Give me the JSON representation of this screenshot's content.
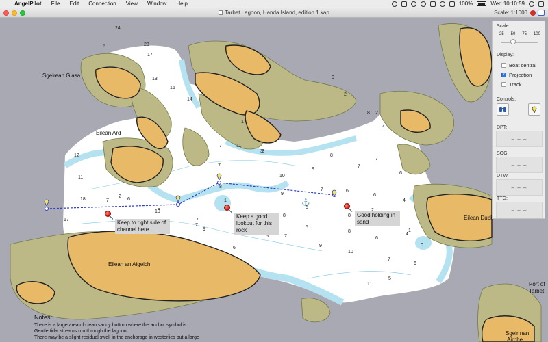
{
  "menubar": {
    "app_name": "AngelPilot",
    "menus": [
      "File",
      "Edit",
      "Connection",
      "View",
      "Window",
      "Help"
    ],
    "battery": "100%",
    "clock": "Wed 10:10:59"
  },
  "window": {
    "title": "Tarbet Lagoon, Handa Island, edition 1.kap",
    "scale_text": "Scale: 1:1000"
  },
  "chart": {
    "places": {
      "sgeirean_glasa": "Sgeirean Glasa",
      "eilean_ard": "Eilean Ard",
      "eilean_dubh": "Eilean Dubh",
      "eilean_an_aigeich": "Eilean an Aigeich",
      "port_of": "Port of",
      "tarbet": "Tarbet",
      "sgeir_nan": "Sgeir nan",
      "airbhe": "Airbhe"
    },
    "soundings": [
      "24",
      "23",
      "17",
      "6",
      "13",
      "16",
      "14",
      "3",
      "1",
      "7",
      "2",
      "0",
      "8",
      "4",
      "11",
      "3",
      "7",
      "8",
      "7",
      "6",
      "10",
      "9",
      "7",
      "8",
      "7",
      "6",
      "12",
      "11",
      "2",
      "6",
      "18",
      "7",
      "9",
      "5",
      "6",
      "4",
      "17",
      "8",
      "10",
      "9",
      "8",
      "8",
      "5",
      "6",
      "4",
      "7",
      "7",
      "6",
      "8",
      "9",
      "10",
      "7",
      "6",
      "11",
      "5",
      "0",
      "4",
      "2",
      "7",
      "5",
      "1",
      "2",
      "1"
    ],
    "callouts": {
      "channel": "Keep to right side of channel here",
      "lookout": "Keep a good lookout for this rock",
      "holding": "Good holding in sand"
    }
  },
  "notes": {
    "heading": "Notes:",
    "lines": [
      "There is a large area of clean sandy bottom where the anchor symbol is.",
      "Gentle tidal streams run through the lagoon.",
      "There may be a slight residual swell in the anchorage in westerlies but a large"
    ]
  },
  "panel": {
    "scale_label": "Scale:",
    "scale_ticks": [
      "25",
      "50",
      "75",
      "100"
    ],
    "scale_value_percent": 50,
    "display_label": "Display:",
    "options": [
      {
        "label": "Boat central",
        "checked": false
      },
      {
        "label": "Projection",
        "checked": true
      },
      {
        "label": "Track",
        "checked": false
      }
    ],
    "controls_label": "Controls:",
    "readouts": [
      {
        "label": "DPT:",
        "value": "– – –"
      },
      {
        "label": "SOG:",
        "value": "– – –"
      },
      {
        "label": "DTW:",
        "value": "– – –"
      },
      {
        "label": "TTG:",
        "value": "– – –"
      }
    ]
  },
  "colors": {
    "land": "#e8b967",
    "drying": "#bcb986",
    "water": "#ffffff",
    "shallow": "#b5e2f0",
    "rock": "#a9a9b3",
    "route": "#2d3bc8"
  }
}
